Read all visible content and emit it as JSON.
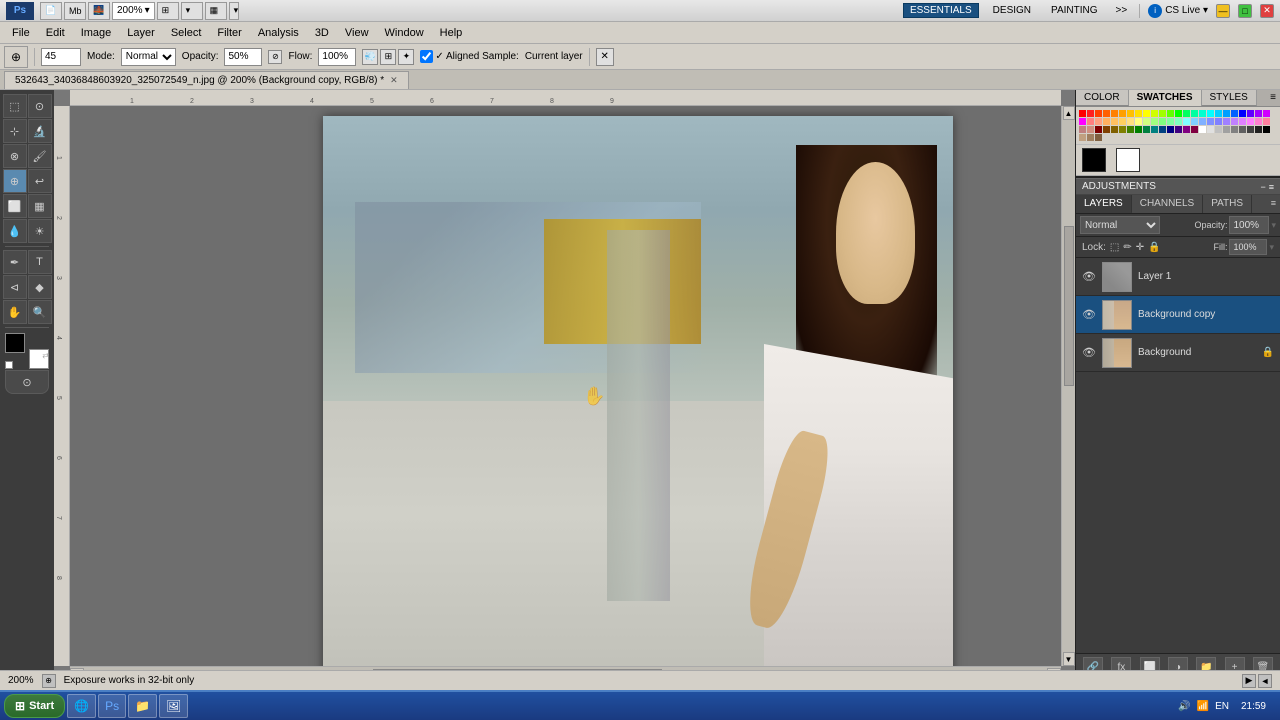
{
  "app": {
    "title": "Adobe Photoshop CS Live",
    "ps_logo": "Ps",
    "document_title": "532643_34036848603920_325072549_n.jpg @ 200% (Background copy, RGB/8) *"
  },
  "titlebar": {
    "tab1": "Mb",
    "zoom_label": "200%",
    "workspace_btn": "▾",
    "minimize": "—",
    "maximize": "□",
    "close": "✕",
    "essentials_label": "ESSENTIALS",
    "design_label": "DESIGN",
    "painting_label": "PAINTING",
    "more_label": ">>",
    "cslive_label": "CS Live ▾"
  },
  "menu": {
    "items": [
      "File",
      "Edit",
      "Image",
      "Layer",
      "Select",
      "Filter",
      "Analysis",
      "3D",
      "View",
      "Window",
      "Help"
    ]
  },
  "options_bar": {
    "mode_label": "Mode:",
    "mode_value": "Normal",
    "opacity_label": "Opacity:",
    "opacity_value": "50%",
    "flow_label": "Flow:",
    "flow_value": "100%",
    "aligned_sample_label": "✓ Aligned Sample:",
    "current_layer_label": "Current layer"
  },
  "color_panel": {
    "tabs": [
      "COLOR",
      "SWATCHES",
      "STYLES"
    ],
    "active_tab": "SWATCHES"
  },
  "adjustments": {
    "label": "ADJUSTMENTS"
  },
  "layers_panel": {
    "tabs": [
      "LAYERS",
      "CHANNELS",
      "PATHS"
    ],
    "active_tab": "LAYERS",
    "blend_mode": "Normal",
    "opacity_label": "Opacity:",
    "opacity_value": "100%",
    "fill_label": "Fill:",
    "fill_value": "100%",
    "lock_label": "Lock:",
    "layers": [
      {
        "name": "Layer 1",
        "visible": true,
        "active": false,
        "locked": false
      },
      {
        "name": "Background copy",
        "visible": true,
        "active": true,
        "locked": false
      },
      {
        "name": "Background",
        "visible": true,
        "active": false,
        "locked": true
      }
    ]
  },
  "status_bar": {
    "zoom": "200%",
    "message": "Exposure works in 32-bit only"
  },
  "taskbar": {
    "start_label": "Start",
    "time": "21:59",
    "apps": [
      "IE",
      "PS",
      "Folder",
      "App4"
    ]
  },
  "tools": {
    "tool1": "⊹",
    "tool2": "○",
    "tool3": "✂",
    "tool4": "⬚",
    "tool5": "⊕",
    "tool6": "T",
    "tool7": "⊘",
    "tool8": "⬛",
    "tool9": "⊙"
  }
}
